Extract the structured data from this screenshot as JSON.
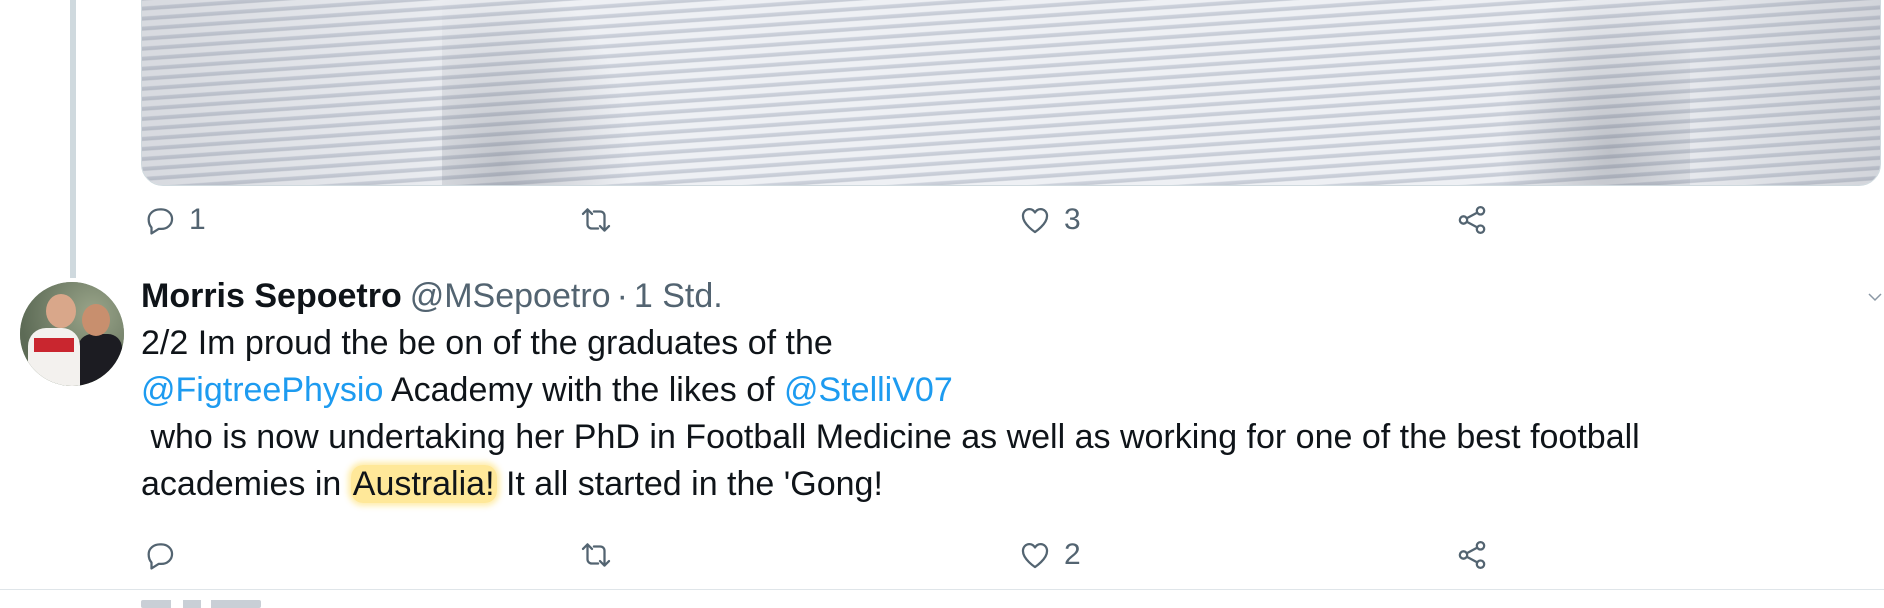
{
  "tweet1": {
    "actions": {
      "reply_count": "1",
      "retweet_count": "",
      "like_count": "3"
    }
  },
  "tweet2": {
    "author_name": "Morris Sepoetro",
    "handle": "@MSepoetro",
    "separator": "·",
    "time": "1 Std.",
    "text": {
      "line1": "2/2 Im proud the be on of the graduates of the",
      "mention1": "@FigtreePhysio",
      "line2_mid": " Academy with the likes of ",
      "mention2": "@StelliV07",
      "line3": " who is now undertaking her PhD in Football Medicine as well as working for one of the best football",
      "line4_pre": "academies in ",
      "highlight": "Australia!",
      "line4_post": " It all started in the 'Gong!"
    },
    "actions": {
      "reply_count": "",
      "retweet_count": "",
      "like_count": "2"
    }
  },
  "icons": {
    "reply": "reply-icon",
    "retweet": "retweet-icon",
    "like": "heart-icon",
    "share": "share-icon"
  },
  "colors": {
    "text_primary": "#0f1419",
    "text_secondary": "#536471",
    "link": "#1d9bf0",
    "highlight": "#ffd646",
    "thread_line": "#cfd9de"
  }
}
